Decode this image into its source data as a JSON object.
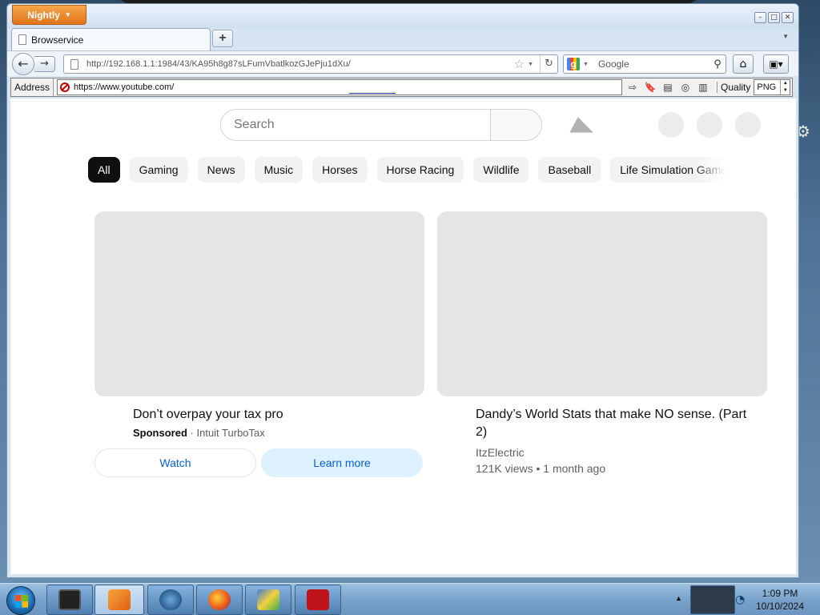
{
  "browser": {
    "app_button_label": "Nightly",
    "tab_title": "Browservice",
    "url": "http://192.168.1.1:1984/43/KA95h8g87sLFumVbatlkozGJePju1dXu/",
    "search_engine_placeholder": "Google",
    "address_label": "Address",
    "address_value": "https://www.youtube.com/",
    "quality_label": "Quality",
    "quality_value": "PNG"
  },
  "youtube": {
    "search_placeholder": "Search",
    "chips": [
      "All",
      "Gaming",
      "News",
      "Music",
      "Horses",
      "Horse Racing",
      "Wildlife",
      "Baseball",
      "Life Simulation Games"
    ],
    "ad": {
      "title": "Don’t overpay your tax pro",
      "sponsored_label": "Sponsored",
      "advertiser": "Intuit TurboTax",
      "watch_label": "Watch",
      "learn_more_label": "Learn more"
    },
    "video": {
      "title": "Dandy’s World Stats that make NO sense. (Part 2)",
      "channel": "ItzElectric",
      "stats": "121K views • 1 month ago"
    }
  },
  "taskbar": {
    "time": "1:09 PM",
    "date": "10/10/2024"
  }
}
